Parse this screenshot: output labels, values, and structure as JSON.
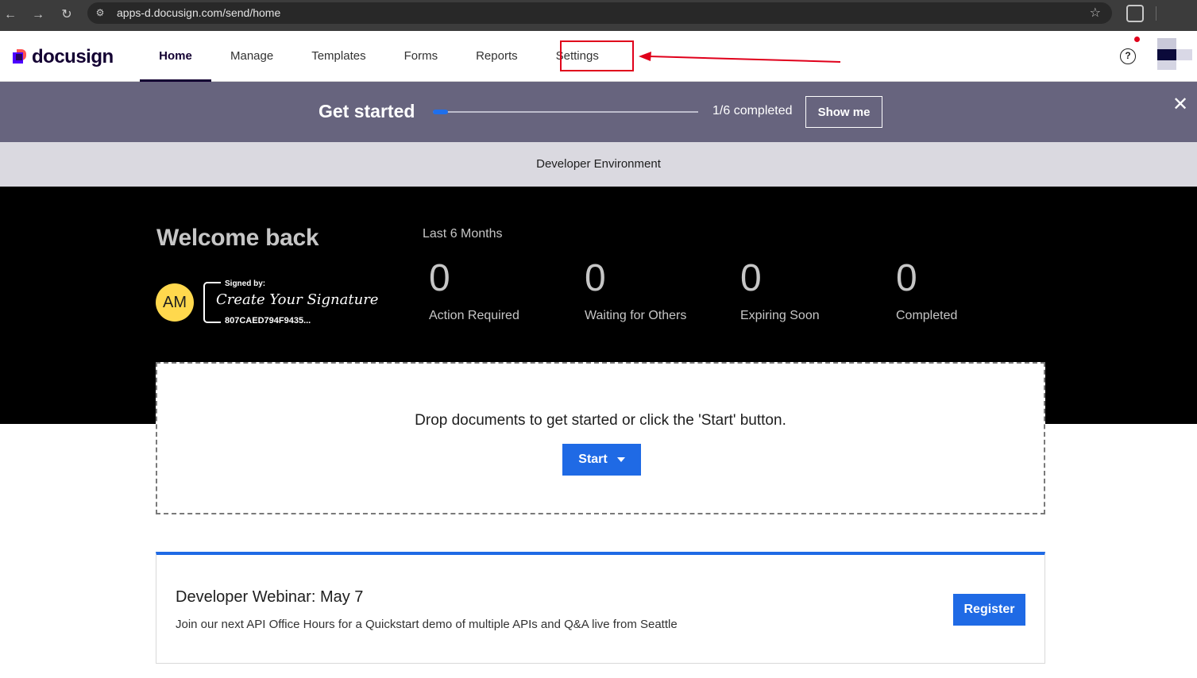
{
  "browser": {
    "url": "apps-d.docusign.com/send/home",
    "back_glyph": "←",
    "forward_glyph": "→",
    "reload_glyph": "↻",
    "site_info_glyph": "⚙",
    "star_glyph": "☆"
  },
  "header": {
    "logo_text": "docusign",
    "nav": [
      {
        "label": "Home",
        "active": true
      },
      {
        "label": "Manage",
        "active": false
      },
      {
        "label": "Templates",
        "active": false
      },
      {
        "label": "Forms",
        "active": false
      },
      {
        "label": "Reports",
        "active": false
      },
      {
        "label": "Settings",
        "active": false
      }
    ],
    "help_glyph": "?",
    "annotation_color": "#e0001b"
  },
  "get_started": {
    "title": "Get started",
    "completed_steps": 1,
    "total_steps": 6,
    "progress_text": "1/6 completed",
    "button_label": "Show me",
    "close_glyph": "✕"
  },
  "environment_banner": "Developer Environment",
  "welcome": {
    "title": "Welcome back",
    "initials": "AM",
    "signature": {
      "signed_by_label": "Signed by:",
      "script_text": "Create Your Signature",
      "id": "807CAED794F9435..."
    },
    "period_label": "Last 6 Months",
    "stats": [
      {
        "value": "0",
        "label": "Action Required"
      },
      {
        "value": "0",
        "label": "Waiting for Others"
      },
      {
        "value": "0",
        "label": "Expiring Soon"
      },
      {
        "value": "0",
        "label": "Completed"
      }
    ]
  },
  "dropzone": {
    "text": "Drop documents to get started or click the 'Start' button.",
    "start_label": "Start"
  },
  "webinar": {
    "title": "Developer Webinar: May 7",
    "description": "Join our next API Office Hours for a Quickstart demo of multiple APIs and Q&A live from Seattle",
    "button_label": "Register"
  },
  "colors": {
    "brand_dark": "#130032",
    "accent_blue": "#1f6ae5",
    "banner_purple": "#67647e",
    "highlight_red": "#e0001b"
  }
}
